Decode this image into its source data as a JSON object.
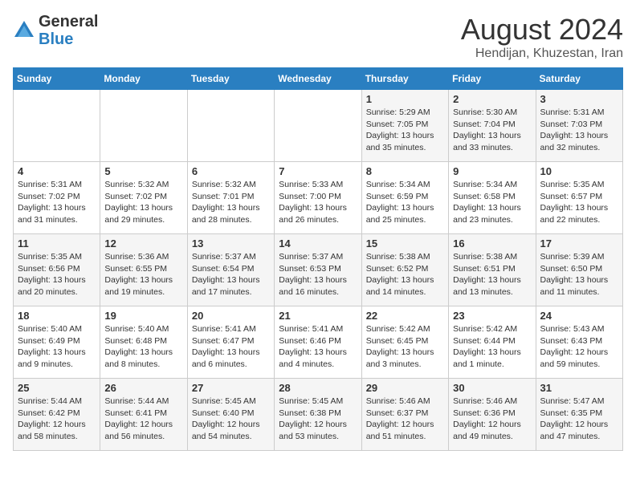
{
  "header": {
    "logo_line1": "General",
    "logo_line2": "Blue",
    "month_title": "August 2024",
    "subtitle": "Hendijan, Khuzestan, Iran"
  },
  "weekdays": [
    "Sunday",
    "Monday",
    "Tuesday",
    "Wednesday",
    "Thursday",
    "Friday",
    "Saturday"
  ],
  "weeks": [
    [
      {
        "day": "",
        "info": ""
      },
      {
        "day": "",
        "info": ""
      },
      {
        "day": "",
        "info": ""
      },
      {
        "day": "",
        "info": ""
      },
      {
        "day": "1",
        "info": "Sunrise: 5:29 AM\nSunset: 7:05 PM\nDaylight: 13 hours\nand 35 minutes."
      },
      {
        "day": "2",
        "info": "Sunrise: 5:30 AM\nSunset: 7:04 PM\nDaylight: 13 hours\nand 33 minutes."
      },
      {
        "day": "3",
        "info": "Sunrise: 5:31 AM\nSunset: 7:03 PM\nDaylight: 13 hours\nand 32 minutes."
      }
    ],
    [
      {
        "day": "4",
        "info": "Sunrise: 5:31 AM\nSunset: 7:02 PM\nDaylight: 13 hours\nand 31 minutes."
      },
      {
        "day": "5",
        "info": "Sunrise: 5:32 AM\nSunset: 7:02 PM\nDaylight: 13 hours\nand 29 minutes."
      },
      {
        "day": "6",
        "info": "Sunrise: 5:32 AM\nSunset: 7:01 PM\nDaylight: 13 hours\nand 28 minutes."
      },
      {
        "day": "7",
        "info": "Sunrise: 5:33 AM\nSunset: 7:00 PM\nDaylight: 13 hours\nand 26 minutes."
      },
      {
        "day": "8",
        "info": "Sunrise: 5:34 AM\nSunset: 6:59 PM\nDaylight: 13 hours\nand 25 minutes."
      },
      {
        "day": "9",
        "info": "Sunrise: 5:34 AM\nSunset: 6:58 PM\nDaylight: 13 hours\nand 23 minutes."
      },
      {
        "day": "10",
        "info": "Sunrise: 5:35 AM\nSunset: 6:57 PM\nDaylight: 13 hours\nand 22 minutes."
      }
    ],
    [
      {
        "day": "11",
        "info": "Sunrise: 5:35 AM\nSunset: 6:56 PM\nDaylight: 13 hours\nand 20 minutes."
      },
      {
        "day": "12",
        "info": "Sunrise: 5:36 AM\nSunset: 6:55 PM\nDaylight: 13 hours\nand 19 minutes."
      },
      {
        "day": "13",
        "info": "Sunrise: 5:37 AM\nSunset: 6:54 PM\nDaylight: 13 hours\nand 17 minutes."
      },
      {
        "day": "14",
        "info": "Sunrise: 5:37 AM\nSunset: 6:53 PM\nDaylight: 13 hours\nand 16 minutes."
      },
      {
        "day": "15",
        "info": "Sunrise: 5:38 AM\nSunset: 6:52 PM\nDaylight: 13 hours\nand 14 minutes."
      },
      {
        "day": "16",
        "info": "Sunrise: 5:38 AM\nSunset: 6:51 PM\nDaylight: 13 hours\nand 13 minutes."
      },
      {
        "day": "17",
        "info": "Sunrise: 5:39 AM\nSunset: 6:50 PM\nDaylight: 13 hours\nand 11 minutes."
      }
    ],
    [
      {
        "day": "18",
        "info": "Sunrise: 5:40 AM\nSunset: 6:49 PM\nDaylight: 13 hours\nand 9 minutes."
      },
      {
        "day": "19",
        "info": "Sunrise: 5:40 AM\nSunset: 6:48 PM\nDaylight: 13 hours\nand 8 minutes."
      },
      {
        "day": "20",
        "info": "Sunrise: 5:41 AM\nSunset: 6:47 PM\nDaylight: 13 hours\nand 6 minutes."
      },
      {
        "day": "21",
        "info": "Sunrise: 5:41 AM\nSunset: 6:46 PM\nDaylight: 13 hours\nand 4 minutes."
      },
      {
        "day": "22",
        "info": "Sunrise: 5:42 AM\nSunset: 6:45 PM\nDaylight: 13 hours\nand 3 minutes."
      },
      {
        "day": "23",
        "info": "Sunrise: 5:42 AM\nSunset: 6:44 PM\nDaylight: 13 hours\nand 1 minute."
      },
      {
        "day": "24",
        "info": "Sunrise: 5:43 AM\nSunset: 6:43 PM\nDaylight: 12 hours\nand 59 minutes."
      }
    ],
    [
      {
        "day": "25",
        "info": "Sunrise: 5:44 AM\nSunset: 6:42 PM\nDaylight: 12 hours\nand 58 minutes."
      },
      {
        "day": "26",
        "info": "Sunrise: 5:44 AM\nSunset: 6:41 PM\nDaylight: 12 hours\nand 56 minutes."
      },
      {
        "day": "27",
        "info": "Sunrise: 5:45 AM\nSunset: 6:40 PM\nDaylight: 12 hours\nand 54 minutes."
      },
      {
        "day": "28",
        "info": "Sunrise: 5:45 AM\nSunset: 6:38 PM\nDaylight: 12 hours\nand 53 minutes."
      },
      {
        "day": "29",
        "info": "Sunrise: 5:46 AM\nSunset: 6:37 PM\nDaylight: 12 hours\nand 51 minutes."
      },
      {
        "day": "30",
        "info": "Sunrise: 5:46 AM\nSunset: 6:36 PM\nDaylight: 12 hours\nand 49 minutes."
      },
      {
        "day": "31",
        "info": "Sunrise: 5:47 AM\nSunset: 6:35 PM\nDaylight: 12 hours\nand 47 minutes."
      }
    ]
  ]
}
